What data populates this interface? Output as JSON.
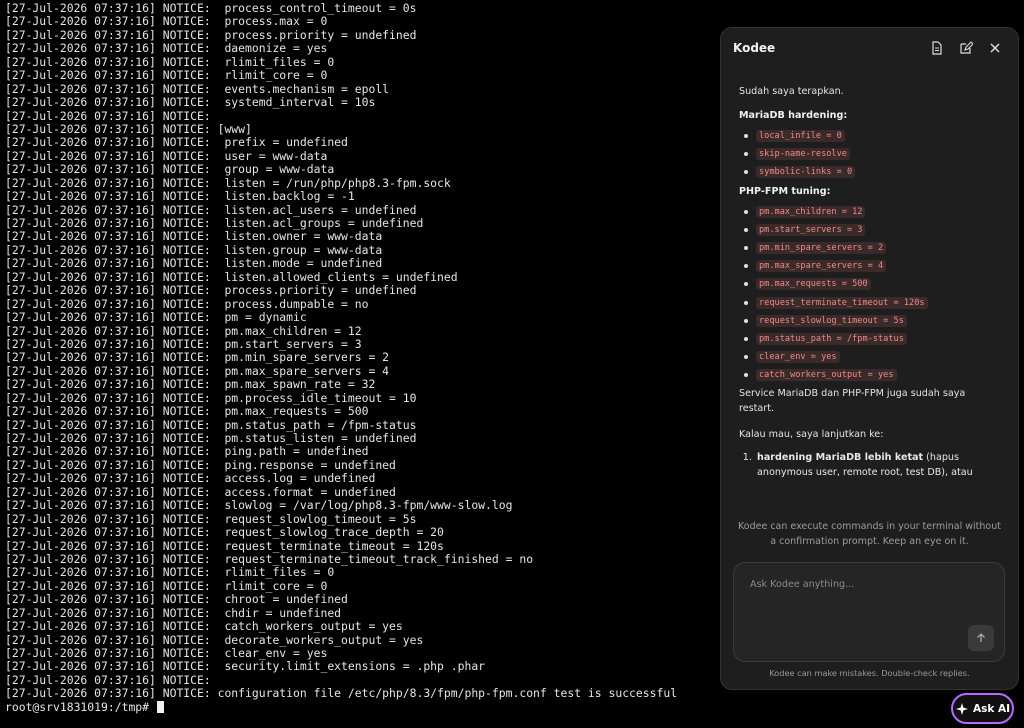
{
  "terminal": {
    "lines": [
      "[27-Jul-2026 07:37:16] NOTICE:  process_control_timeout = 0s",
      "[27-Jul-2026 07:37:16] NOTICE:  process.max = 0",
      "[27-Jul-2026 07:37:16] NOTICE:  process.priority = undefined",
      "[27-Jul-2026 07:37:16] NOTICE:  daemonize = yes",
      "[27-Jul-2026 07:37:16] NOTICE:  rlimit_files = 0",
      "[27-Jul-2026 07:37:16] NOTICE:  rlimit_core = 0",
      "[27-Jul-2026 07:37:16] NOTICE:  events.mechanism = epoll",
      "[27-Jul-2026 07:37:16] NOTICE:  systemd_interval = 10s",
      "[27-Jul-2026 07:37:16] NOTICE:",
      "[27-Jul-2026 07:37:16] NOTICE: [www]",
      "[27-Jul-2026 07:37:16] NOTICE:  prefix = undefined",
      "[27-Jul-2026 07:37:16] NOTICE:  user = www-data",
      "[27-Jul-2026 07:37:16] NOTICE:  group = www-data",
      "[27-Jul-2026 07:37:16] NOTICE:  listen = /run/php/php8.3-fpm.sock",
      "[27-Jul-2026 07:37:16] NOTICE:  listen.backlog = -1",
      "[27-Jul-2026 07:37:16] NOTICE:  listen.acl_users = undefined",
      "[27-Jul-2026 07:37:16] NOTICE:  listen.acl_groups = undefined",
      "[27-Jul-2026 07:37:16] NOTICE:  listen.owner = www-data",
      "[27-Jul-2026 07:37:16] NOTICE:  listen.group = www-data",
      "[27-Jul-2026 07:37:16] NOTICE:  listen.mode = undefined",
      "[27-Jul-2026 07:37:16] NOTICE:  listen.allowed_clients = undefined",
      "[27-Jul-2026 07:37:16] NOTICE:  process.priority = undefined",
      "[27-Jul-2026 07:37:16] NOTICE:  process.dumpable = no",
      "[27-Jul-2026 07:37:16] NOTICE:  pm = dynamic",
      "[27-Jul-2026 07:37:16] NOTICE:  pm.max_children = 12",
      "[27-Jul-2026 07:37:16] NOTICE:  pm.start_servers = 3",
      "[27-Jul-2026 07:37:16] NOTICE:  pm.min_spare_servers = 2",
      "[27-Jul-2026 07:37:16] NOTICE:  pm.max_spare_servers = 4",
      "[27-Jul-2026 07:37:16] NOTICE:  pm.max_spawn_rate = 32",
      "[27-Jul-2026 07:37:16] NOTICE:  pm.process_idle_timeout = 10",
      "[27-Jul-2026 07:37:16] NOTICE:  pm.max_requests = 500",
      "[27-Jul-2026 07:37:16] NOTICE:  pm.status_path = /fpm-status",
      "[27-Jul-2026 07:37:16] NOTICE:  pm.status_listen = undefined",
      "[27-Jul-2026 07:37:16] NOTICE:  ping.path = undefined",
      "[27-Jul-2026 07:37:16] NOTICE:  ping.response = undefined",
      "[27-Jul-2026 07:37:16] NOTICE:  access.log = undefined",
      "[27-Jul-2026 07:37:16] NOTICE:  access.format = undefined",
      "[27-Jul-2026 07:37:16] NOTICE:  slowlog = /var/log/php8.3-fpm/www-slow.log",
      "[27-Jul-2026 07:37:16] NOTICE:  request_slowlog_timeout = 5s",
      "[27-Jul-2026 07:37:16] NOTICE:  request_slowlog_trace_depth = 20",
      "[27-Jul-2026 07:37:16] NOTICE:  request_terminate_timeout = 120s",
      "[27-Jul-2026 07:37:16] NOTICE:  request_terminate_timeout_track_finished = no",
      "[27-Jul-2026 07:37:16] NOTICE:  rlimit_files = 0",
      "[27-Jul-2026 07:37:16] NOTICE:  rlimit_core = 0",
      "[27-Jul-2026 07:37:16] NOTICE:  chroot = undefined",
      "[27-Jul-2026 07:37:16] NOTICE:  chdir = undefined",
      "[27-Jul-2026 07:37:16] NOTICE:  catch_workers_output = yes",
      "[27-Jul-2026 07:37:16] NOTICE:  decorate_workers_output = yes",
      "[27-Jul-2026 07:37:16] NOTICE:  clear_env = yes",
      "[27-Jul-2026 07:37:16] NOTICE:  security.limit_extensions = .php .phar",
      "[27-Jul-2026 07:37:16] NOTICE:",
      "[27-Jul-2026 07:37:16] NOTICE: configuration file /etc/php/8.3/fpm/php-fpm.conf test is successful"
    ],
    "prompt": "root@srv1831019:/tmp# "
  },
  "kodee": {
    "title": "Kodee",
    "icons": [
      "document-icon",
      "edit-icon",
      "close-icon"
    ],
    "intro": "Sudah saya terapkan.",
    "mariadb_heading": "MariaDB hardening:",
    "mariadb_items": [
      "local_infile = 0",
      "skip-name-resolve",
      "symbolic-links = 0"
    ],
    "phpfpm_heading": "PHP-FPM tuning:",
    "phpfpm_items": [
      "pm.max_children = 12",
      "pm.start_servers = 3",
      "pm.min_spare_servers = 2",
      "pm.max_spare_servers = 4",
      "pm.max_requests = 500",
      "request_terminate_timeout = 120s",
      "request_slowlog_timeout = 5s",
      "pm.status_path = /fpm-status",
      "clear_env = yes",
      "catch_workers_output = yes"
    ],
    "service_note": "Service MariaDB dan PHP-FPM juga sudah saya restart.",
    "followup_intro": "Kalau mau, saya lanjutkan ke:",
    "followup_bold": "hardening MariaDB lebih ketat",
    "followup_rest": " (hapus anonymous user, remote root, test DB), atau",
    "warning": "Kodee can execute commands in your terminal without a confirmation prompt. Keep an eye on it.",
    "input_placeholder": "Ask Kodee anything...",
    "disclaimer": "Kodee can make mistakes. Double-check replies.",
    "accent_code_color": "#f08a8a"
  },
  "ask_ai": {
    "label": "Ask AI",
    "border_color": "#b36bff"
  }
}
